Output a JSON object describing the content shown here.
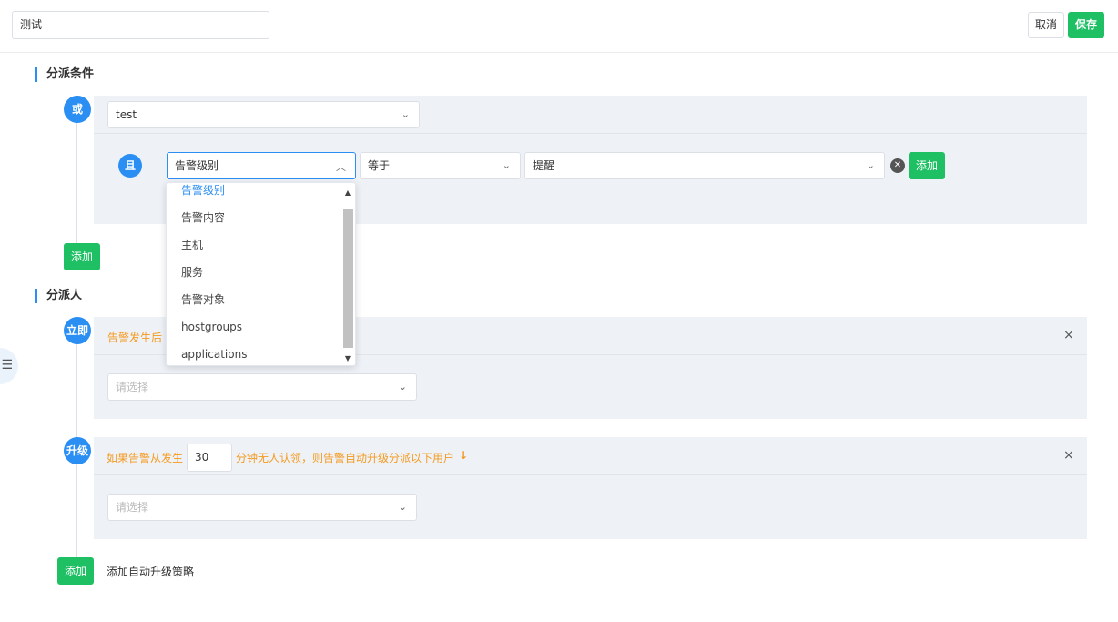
{
  "header": {
    "name_value": "测试",
    "cancel_label": "取消",
    "save_label": "保存"
  },
  "conditions": {
    "title": "分派条件",
    "or_label": "或",
    "group_select_value": "test",
    "and_label": "且",
    "field_select_value": "告警级别",
    "operator_select_value": "等于",
    "value_select_value": "提醒",
    "add_condition_label": "添加",
    "add_group_label": "添加",
    "field_options": [
      "告警级别",
      "告警内容",
      "主机",
      "服务",
      "告警对象",
      "hostgroups",
      "applications"
    ]
  },
  "assignees": {
    "title": "分派人",
    "immediate": {
      "badge": "立即",
      "text": "告警发生后",
      "select_placeholder": "请选择"
    },
    "escalate": {
      "badge": "升级",
      "text_before": "如果告警从发生",
      "minutes_value": "30",
      "text_after": "分钟无人认领，则告警自动升级分派以下用户",
      "select_placeholder": "请选择"
    },
    "add_button_label": "添加",
    "add_policy_text": "添加自动升级策略"
  },
  "icons": {
    "chevron": "chevron-down-icon",
    "close": "close-icon",
    "clear": "clear-circle-icon",
    "arrow_down": "arrow-down-icon",
    "side": "list-icon"
  },
  "colors": {
    "accent": "#2a8ef2",
    "success": "#1fbf64",
    "warning": "#f59a1f",
    "panel_bg": "#eef2f7"
  }
}
